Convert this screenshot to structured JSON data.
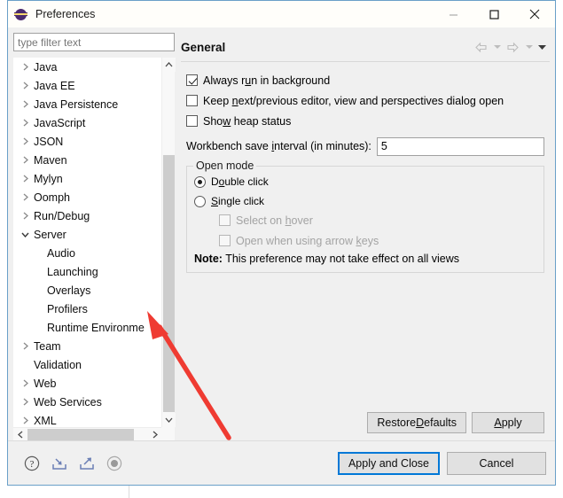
{
  "window": {
    "title": "Preferences",
    "icon": "eclipse-logo-icon",
    "controls": {
      "minimize": "minimize-icon",
      "maximize": "maximize-icon",
      "close": "close-icon"
    }
  },
  "filter": {
    "placeholder": "type filter text",
    "value": ""
  },
  "tree": {
    "items": [
      {
        "label": "Java",
        "level": 0,
        "twisty": "collapsed"
      },
      {
        "label": "Java EE",
        "level": 0,
        "twisty": "collapsed"
      },
      {
        "label": "Java Persistence",
        "level": 0,
        "twisty": "collapsed"
      },
      {
        "label": "JavaScript",
        "level": 0,
        "twisty": "collapsed"
      },
      {
        "label": "JSON",
        "level": 0,
        "twisty": "collapsed"
      },
      {
        "label": "Maven",
        "level": 0,
        "twisty": "collapsed"
      },
      {
        "label": "Mylyn",
        "level": 0,
        "twisty": "collapsed"
      },
      {
        "label": "Oomph",
        "level": 0,
        "twisty": "collapsed"
      },
      {
        "label": "Run/Debug",
        "level": 0,
        "twisty": "collapsed"
      },
      {
        "label": "Server",
        "level": 0,
        "twisty": "expanded"
      },
      {
        "label": "Audio",
        "level": 1,
        "twisty": "none"
      },
      {
        "label": "Launching",
        "level": 1,
        "twisty": "none"
      },
      {
        "label": "Overlays",
        "level": 1,
        "twisty": "none"
      },
      {
        "label": "Profilers",
        "level": 1,
        "twisty": "none"
      },
      {
        "label": "Runtime Environme",
        "level": 1,
        "twisty": "none"
      },
      {
        "label": "Team",
        "level": 0,
        "twisty": "collapsed"
      },
      {
        "label": "Validation",
        "level": 0,
        "twisty": "none"
      },
      {
        "label": "Web",
        "level": 0,
        "twisty": "collapsed"
      },
      {
        "label": "Web Services",
        "level": 0,
        "twisty": "collapsed"
      },
      {
        "label": "XML",
        "level": 0,
        "twisty": "collapsed"
      }
    ]
  },
  "page": {
    "title": "General",
    "nav": {
      "back": "back-arrow-icon",
      "back_menu": "back-dropdown-icon",
      "forward": "forward-arrow-icon",
      "forward_menu": "forward-dropdown-icon",
      "menu": "view-menu-icon"
    },
    "checkboxes": [
      {
        "label": "Always run in background",
        "mnemonic": "u",
        "checked": true,
        "enabled": true
      },
      {
        "label": "Keep next/previous editor, view and perspectives dialog open",
        "mnemonic": "n",
        "checked": false,
        "enabled": true
      },
      {
        "label": "Show heap status",
        "mnemonic": "w",
        "checked": false,
        "enabled": true
      }
    ],
    "save_interval": {
      "label": "Workbench save interval (in minutes):",
      "mnemonic": "i",
      "value": "5"
    },
    "open_mode": {
      "title": "Open mode",
      "radios": [
        {
          "label": "Double click",
          "mnemonic": "o",
          "selected": true
        },
        {
          "label": "Single click",
          "mnemonic": "S",
          "selected": false
        }
      ],
      "sub_checkboxes": [
        {
          "label": "Select on hover",
          "mnemonic": "h",
          "checked": false,
          "enabled": false
        },
        {
          "label": "Open when using arrow keys",
          "mnemonic": "k",
          "checked": false,
          "enabled": false
        }
      ],
      "note_prefix": "Note:",
      "note_text": "This preference may not take effect on all views"
    },
    "buttons": {
      "restore_defaults": "Restore Defaults",
      "restore_defaults_mnemonic": "D",
      "apply": "Apply",
      "apply_mnemonic": "A"
    }
  },
  "footer": {
    "icons": [
      {
        "name": "help-icon"
      },
      {
        "name": "import-icon"
      },
      {
        "name": "export-icon"
      },
      {
        "name": "record-icon"
      }
    ],
    "apply_and_close": "Apply and Close",
    "cancel": "Cancel"
  },
  "annotation": {
    "type": "red-arrow",
    "color": "#ef3b32",
    "points_to": "Runtime Environme"
  },
  "colors": {
    "accent": "#0078d7",
    "dialog_border": "#6aa0c8",
    "dialog_bg": "#f0f0f0",
    "annotation": "#ef3b32"
  }
}
